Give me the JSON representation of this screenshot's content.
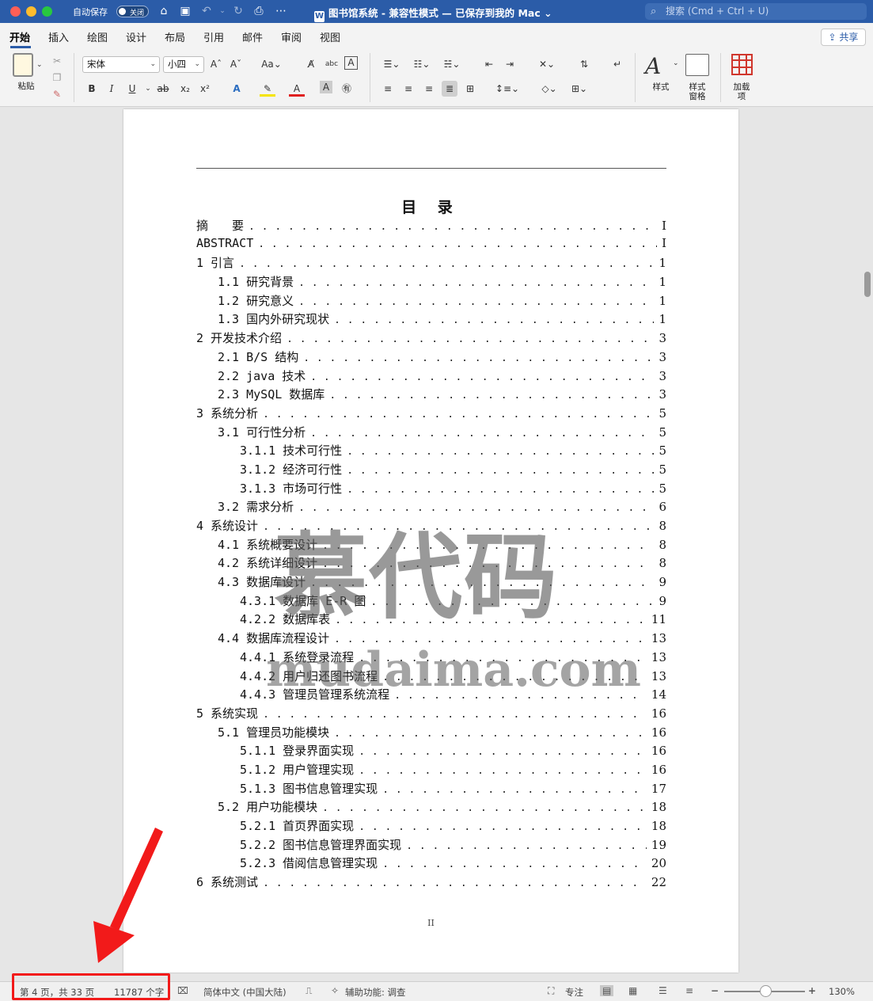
{
  "titlebar": {
    "autosave_label": "自动保存",
    "toggle_text": "关闭",
    "doc_title": "图书馆系统 - 兼容性模式 — 已保存到我的 Mac",
    "search_placeholder": "搜索 (Cmd + Ctrl + U)"
  },
  "ribbon_tabs": [
    "开始",
    "插入",
    "绘图",
    "设计",
    "布局",
    "引用",
    "邮件",
    "审阅",
    "视图"
  ],
  "share_label": "共享",
  "ribbon": {
    "paste_label": "粘贴",
    "font_name": "宋体",
    "font_size": "小四",
    "styles_label": "样式",
    "styles_pane_label": "样式\n窗格",
    "addins_label": "加载\n项"
  },
  "document": {
    "toc_title": "目 录",
    "toc": [
      {
        "label": "摘　　要",
        "page": "I",
        "level": 1
      },
      {
        "label": "ABSTRACT",
        "page": "I",
        "level": 1
      },
      {
        "label": "1 引言",
        "page": "1",
        "level": 1
      },
      {
        "label": "1.1 研究背景",
        "page": "1",
        "level": 2
      },
      {
        "label": "1.2 研究意义",
        "page": "1",
        "level": 2
      },
      {
        "label": "1.3 国内外研究现状",
        "page": "1",
        "level": 2
      },
      {
        "label": "2 开发技术介绍",
        "page": "3",
        "level": 1
      },
      {
        "label": "2.1 B/S 结构",
        "page": "3",
        "level": 2
      },
      {
        "label": "2.2 java 技术",
        "page": "3",
        "level": 2
      },
      {
        "label": "2.3 MySQL 数据库",
        "page": "3",
        "level": 2
      },
      {
        "label": "3 系统分析",
        "page": "5",
        "level": 1
      },
      {
        "label": "3.1 可行性分析",
        "page": "5",
        "level": 2
      },
      {
        "label": "3.1.1 技术可行性",
        "page": "5",
        "level": 3
      },
      {
        "label": "3.1.2 经济可行性",
        "page": "5",
        "level": 3
      },
      {
        "label": "3.1.3 市场可行性",
        "page": "5",
        "level": 3
      },
      {
        "label": "3.2 需求分析",
        "page": "6",
        "level": 2
      },
      {
        "label": "4 系统设计",
        "page": "8",
        "level": 1
      },
      {
        "label": "4.1 系统概要设计",
        "page": "8",
        "level": 2
      },
      {
        "label": "4.2 系统详细设计",
        "page": "8",
        "level": 2
      },
      {
        "label": "4.3 数据库设计",
        "page": "9",
        "level": 2
      },
      {
        "label": "4.3.1 数据库 E-R 图",
        "page": "9",
        "level": 3
      },
      {
        "label": "4.2.2 数据库表",
        "page": "11",
        "level": 3
      },
      {
        "label": "4.4 数据库流程设计",
        "page": "13",
        "level": 2
      },
      {
        "label": "4.4.1 系统登录流程",
        "page": "13",
        "level": 3
      },
      {
        "label": "4.4.2 用户归还图书流程",
        "page": "13",
        "level": 3
      },
      {
        "label": "4.4.3 管理员管理系统流程",
        "page": "14",
        "level": 3
      },
      {
        "label": "5 系统实现",
        "page": "16",
        "level": 1
      },
      {
        "label": "5.1 管理员功能模块",
        "page": "16",
        "level": 2
      },
      {
        "label": "5.1.1 登录界面实现",
        "page": "16",
        "level": 3
      },
      {
        "label": "5.1.2 用户管理实现",
        "page": "16",
        "level": 3
      },
      {
        "label": "5.1.3 图书信息管理实现",
        "page": "17",
        "level": 3
      },
      {
        "label": "5.2 用户功能模块",
        "page": "18",
        "level": 2
      },
      {
        "label": "5.2.1 首页界面实现",
        "page": "18",
        "level": 3
      },
      {
        "label": "5.2.2 图书信息管理界面实现",
        "page": "19",
        "level": 3
      },
      {
        "label": "5.2.3 借阅信息管理实现",
        "page": "20",
        "level": 3
      },
      {
        "label": "6 系统测试",
        "page": "22",
        "level": 1
      }
    ],
    "page_number": "II",
    "watermark_cn": "慕代码",
    "watermark_en": "mudaima.com"
  },
  "statusbar": {
    "page_info": "第 4 页，共 33 页",
    "word_count": "11787 个字",
    "language": "简体中文 (中国大陆)",
    "accessibility": "辅助功能: 调查",
    "focus": "专注",
    "zoom": "130%"
  },
  "colors": {
    "titlebar": "#2b5ca8",
    "highlight": "#f21a1a"
  }
}
